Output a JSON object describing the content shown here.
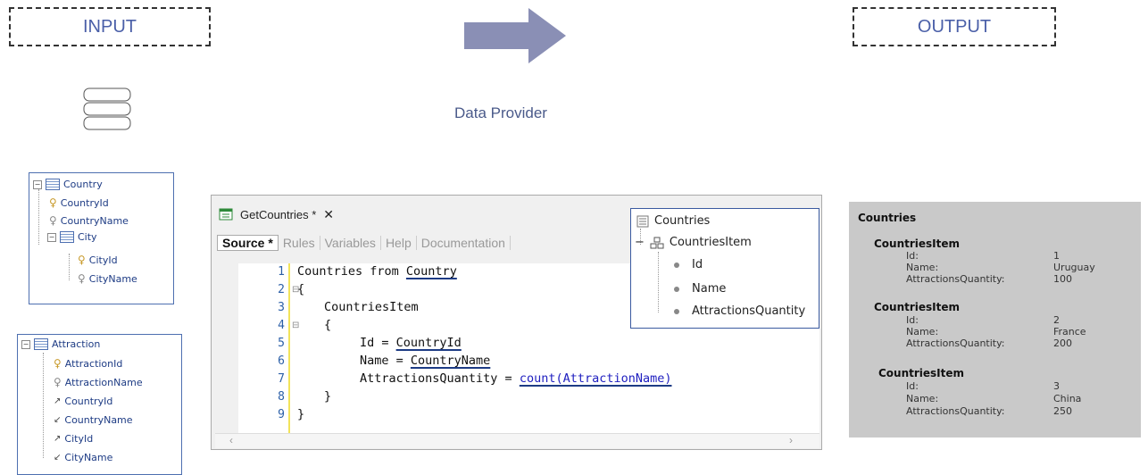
{
  "input_label": "INPUT",
  "output_label": "OUTPUT",
  "middle_label": "Data Provider",
  "country_tree": {
    "root": "Country",
    "items": [
      "CountryId",
      "CountryName",
      "City",
      "CityId",
      "CityName"
    ]
  },
  "attraction_tree": {
    "root": "Attraction",
    "items": [
      "AttractionId",
      "AttractionName",
      "CountryId",
      "CountryName",
      "CityId",
      "CityName"
    ]
  },
  "editor": {
    "tab_title": "GetCountries *",
    "close": "✕",
    "subtabs": [
      "Source *",
      "Rules",
      "Variables",
      "Help",
      "Documentation"
    ],
    "line_numbers": [
      "1",
      "2",
      "3",
      "4",
      "5",
      "6",
      "7",
      "8",
      "9"
    ],
    "code": {
      "l1_a": "Countries from ",
      "l1_b": "Country",
      "l2": "{",
      "l3": "CountriesItem",
      "l4": "{",
      "l5_a": "Id = ",
      "l5_b": "CountryId",
      "l6_a": "Name = ",
      "l6_b": "CountryName",
      "l7_a": "AttractionsQuantity = ",
      "l7_b": "count(AttractionName)",
      "l8": "}",
      "l9": "}"
    }
  },
  "structure_popup": {
    "root": "Countries",
    "item": "CountriesItem",
    "fields": [
      "Id",
      "Name",
      "AttractionsQuantity"
    ]
  },
  "output": {
    "root": "Countries",
    "items": [
      {
        "title": "CountriesItem",
        "id_label": "Id:",
        "name_label": "Name:",
        "qty_label": "AttractionsQuantity:",
        "id": "1",
        "name": "Uruguay",
        "qty": "100"
      },
      {
        "title": "CountriesItem",
        "id_label": "Id:",
        "name_label": "Name:",
        "qty_label": "AttractionsQuantity:",
        "id": "2",
        "name": "France",
        "qty": "200"
      },
      {
        "title": "CountriesItem",
        "id_label": "Id:",
        "name_label": "Name:",
        "qty_label": "AttractionsQuantity:",
        "id": "3",
        "name": "China",
        "qty": "250"
      }
    ]
  }
}
